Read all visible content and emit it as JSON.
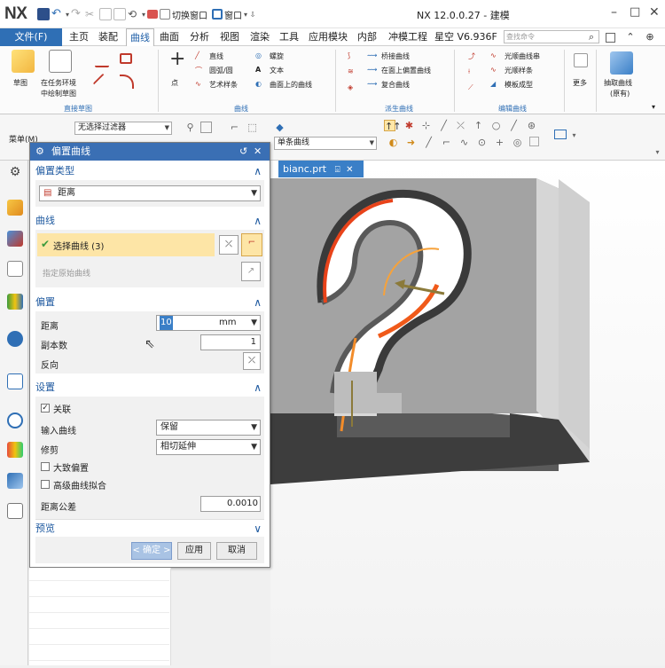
{
  "app": {
    "logo": "NX",
    "window_title": "NX 12.0.0.27 - 建模",
    "quick_access": {
      "switch_window": "切换窗口",
      "window_menu": "窗口"
    }
  },
  "tabs": {
    "file": "文件(F)",
    "items": [
      "主页",
      "装配",
      "曲线",
      "曲面",
      "分析",
      "视图",
      "渲染",
      "工具",
      "应用模块",
      "内部",
      "冲模工程",
      "星空 V6.936F"
    ],
    "active": "曲线",
    "search_placeholder": "查找命令"
  },
  "ribbon": {
    "sketch": "草图",
    "sketch_in_task_line1": "在任务环境",
    "sketch_in_task_line2": "中绘制草图",
    "direct_sketch_group": "直接草图",
    "point": "点",
    "line": "直线",
    "arc_circle": "圆弧/圆",
    "art_spline": "艺术样条",
    "helix": "螺旋",
    "text": "文本",
    "curve_on_surface": "曲面上的曲线",
    "curve_group": "曲线",
    "bridge_curve": "桥接曲线",
    "project_curve": "在面上偏置曲线",
    "composite_curve": "复合曲线",
    "derived_group": "派生曲线",
    "smooth_curve": "光顺曲线串",
    "smooth_spline": "光顺样条",
    "template_forming": "模板成型",
    "edit_group": "编辑曲线",
    "more": "更多",
    "extract_line1": "抽取曲线",
    "extract_line2": "(原有)"
  },
  "toolbar2": {
    "menu": "菜单(M)",
    "filter": "无选择过滤器",
    "curve_rule": "单条曲线"
  },
  "document_tab": "bianc.prt",
  "dialog": {
    "title": "偏置曲线",
    "offset_type_header": "偏置类型",
    "offset_type_value": "距离",
    "curve_header": "曲线",
    "select_curve": "选择曲线 (3)",
    "specify_original": "指定原始曲线",
    "offset_header": "偏置",
    "distance_label": "距离",
    "distance_value": "10",
    "distance_unit": "mm",
    "copies_label": "副本数",
    "copies_value": "1",
    "reverse_label": "反向",
    "settings_header": "设置",
    "associative": "关联",
    "input_curve_label": "输入曲线",
    "input_curve_value": "保留",
    "trim_label": "修剪",
    "trim_value": "相切延伸",
    "large_offset": "大致偏置",
    "advanced_fit": "高级曲线拟合",
    "tolerance_label": "距离公差",
    "tolerance_value": "0.0010",
    "preview_header": "预览",
    "ok": "< 确定 >",
    "apply": "应用",
    "cancel": "取消"
  },
  "colors": {
    "accent": "#2f6fb5",
    "dialog_title_bg": "#3a6fb4",
    "highlight_row": "#fde5a6",
    "offset_curve": "#f05a1a",
    "model_face": "#9c9c9c",
    "model_dark": "#4d4d4d"
  }
}
